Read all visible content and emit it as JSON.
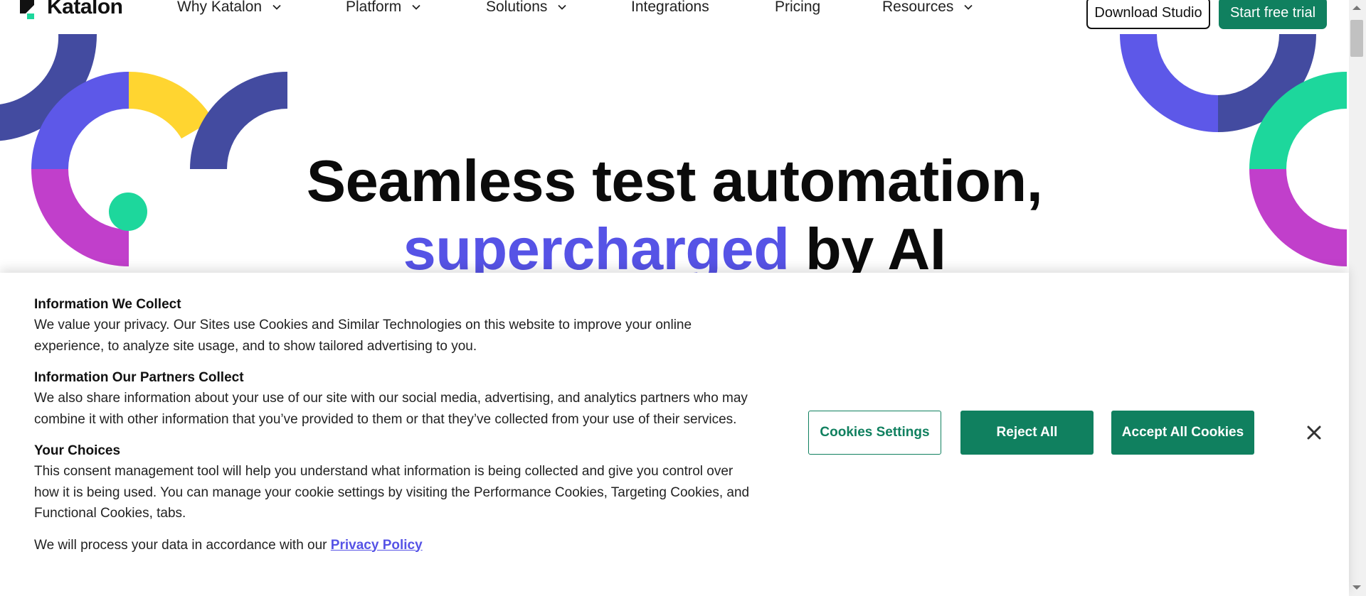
{
  "nav": {
    "brand": "Katalon",
    "items": [
      {
        "label": "Why Katalon",
        "dropdown": true
      },
      {
        "label": "Platform",
        "dropdown": true
      },
      {
        "label": "Solutions",
        "dropdown": true
      },
      {
        "label": "Integrations",
        "dropdown": false
      },
      {
        "label": "Pricing",
        "dropdown": false
      },
      {
        "label": "Resources",
        "dropdown": true
      }
    ],
    "download_label": "Download Studio",
    "trial_label": "Start free trial"
  },
  "hero": {
    "line1": "Seamless test automation,",
    "line2_accent": "supercharged",
    "line2_rest": " by AI"
  },
  "cookie_banner": {
    "sections": [
      {
        "heading": "Information We Collect",
        "body": "We value your privacy. Our Sites use Cookies and Similar Technologies on this website to improve your online experience, to analyze site usage, and to show tailored advertising to you."
      },
      {
        "heading": "Information Our Partners Collect",
        "body": "We also share information about your use of our site with our social media, advertising, and analytics partners who may combine it with other information that you’ve provided to them or that they’ve collected from your use of their services."
      },
      {
        "heading": "Your Choices",
        "body": "This consent management tool will help you understand what information is being collected and give you control over how it is being used. You can manage your cookie settings by visiting the Performance Cookies, Targeting Cookies, and Functional Cookies, tabs."
      }
    ],
    "footer_text": "We will process your data in accordance with our ",
    "privacy_link": "Privacy Policy",
    "settings_label": "Cookies Settings",
    "reject_label": "Reject All",
    "accept_label": "Accept All Cookies"
  },
  "colors": {
    "brand_green": "#10805f",
    "accent_purple": "#5653e6",
    "deco_navy": "#434ba0",
    "deco_indigo": "#5d58e8",
    "deco_yellow": "#ffd530",
    "deco_magenta": "#c13fcb",
    "deco_teal": "#1dd79c"
  },
  "icons": [
    "katalon-logo-icon",
    "chevron-down-icon",
    "close-icon"
  ]
}
